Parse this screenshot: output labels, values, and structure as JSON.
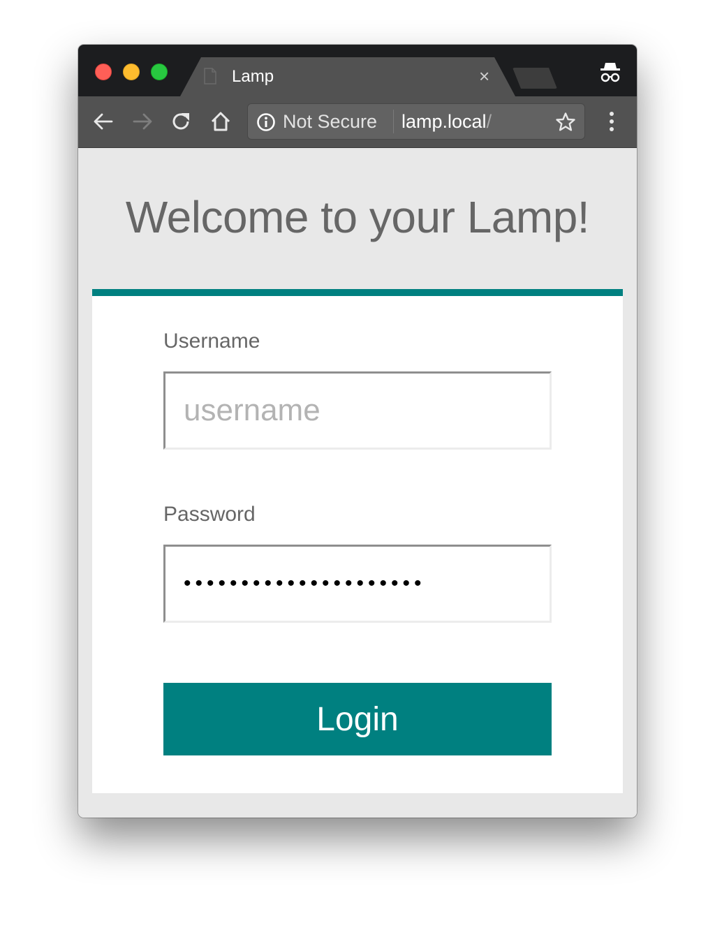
{
  "browser": {
    "tab": {
      "title": "Lamp",
      "close_glyph": "×"
    },
    "icons": {
      "tab_favicon": "document-icon",
      "incognito": "incognito-icon",
      "back": "arrow-left-icon",
      "forward": "arrow-right-icon",
      "reload": "reload-icon",
      "home": "home-icon",
      "info": "info-icon",
      "bookmark": "star-icon",
      "menu": "vertical-dots-icon"
    },
    "omnibox": {
      "security_label": "Not Secure",
      "url_host": "lamp.local",
      "url_path": "/"
    }
  },
  "page": {
    "heading": "Welcome to your Lamp!",
    "form": {
      "username_label": "Username",
      "username_value": "",
      "username_placeholder": "username",
      "password_label": "Password",
      "password_masked_value": "•••••••••••••••••••••",
      "password_length": 21,
      "login_label": "Login"
    }
  },
  "colors": {
    "accent": "#008080",
    "heading_text": "#666666",
    "page_background": "#e8e8e8"
  }
}
